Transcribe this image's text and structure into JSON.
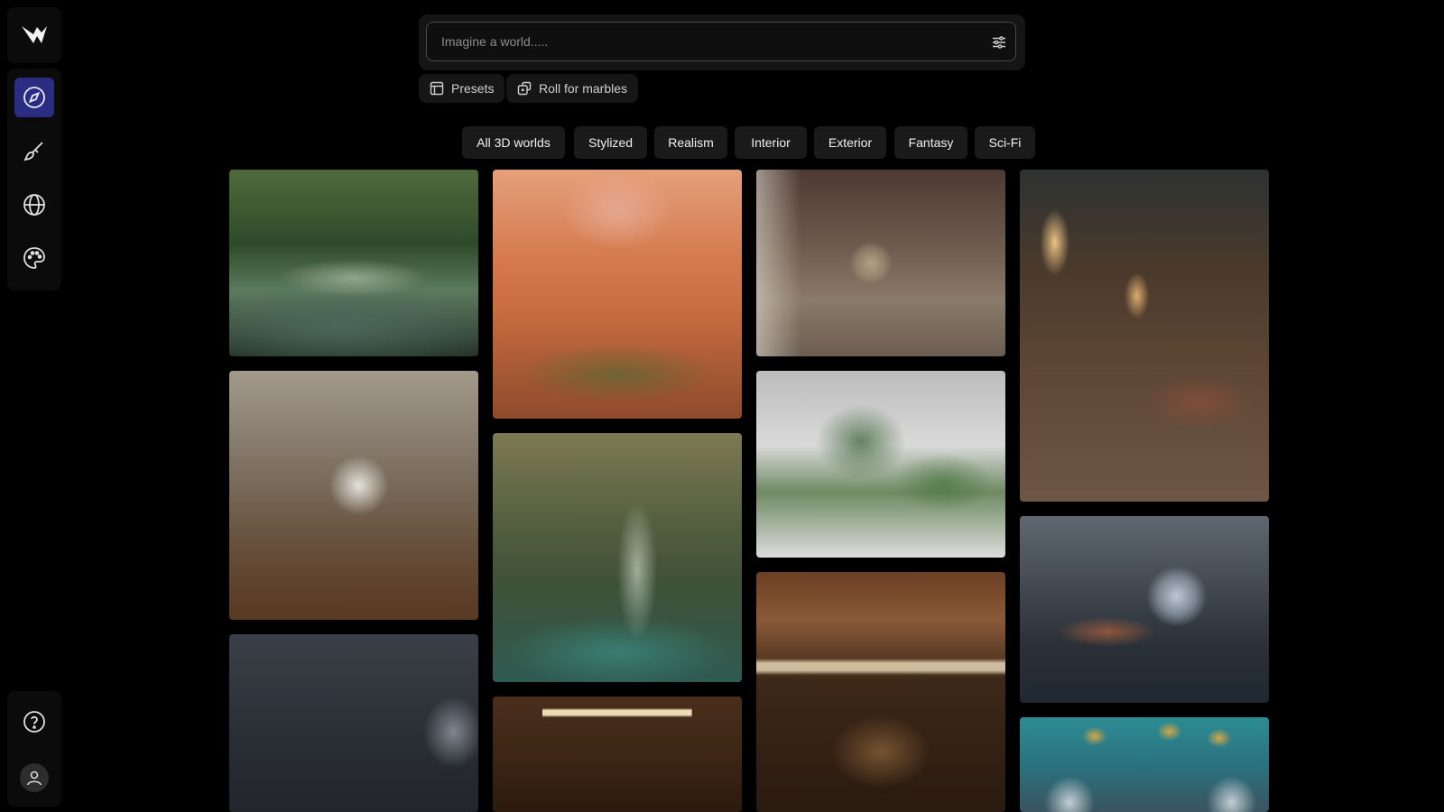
{
  "sidebar": {
    "logo_icon": "brand-logo-icon",
    "items": [
      {
        "icon": "compass-icon",
        "name": "explore",
        "active": true
      },
      {
        "icon": "brush-icon",
        "name": "create"
      },
      {
        "icon": "globe-icon",
        "name": "worlds"
      },
      {
        "icon": "palette-icon",
        "name": "styles"
      }
    ],
    "help_icon": "help-icon",
    "avatar_icon": "user-icon",
    "active_color": "#2b2d82"
  },
  "search": {
    "placeholder": "Imagine a world.....",
    "filter_icon": "sliders-icon"
  },
  "actions": {
    "presets_label": "Presets",
    "presets_icon": "layout-icon",
    "roll_label": "Roll for marbles",
    "roll_icon": "dice-icon"
  },
  "tabs": [
    "All 3D worlds",
    "Stylized",
    "Realism",
    "Interior",
    "Exterior",
    "Fantasy",
    "Sci-Fi"
  ],
  "gallery": [
    {
      "id": "jungle-pods",
      "column": 1
    },
    {
      "id": "abandoned-bedroom",
      "column": 1
    },
    {
      "id": "dark-mansion-room",
      "column": 1
    },
    {
      "id": "orange-palace",
      "column": 2
    },
    {
      "id": "ruins-waterfall",
      "column": 2
    },
    {
      "id": "log-cabin",
      "column": 2
    },
    {
      "id": "library-study",
      "column": 3
    },
    {
      "id": "white-bonsai-terrace",
      "column": 3
    },
    {
      "id": "wooden-kitchen",
      "column": 3
    },
    {
      "id": "lantern-library",
      "column": 4
    },
    {
      "id": "spaceship-cabin",
      "column": 4
    },
    {
      "id": "teal-dome-room",
      "column": 4
    }
  ]
}
